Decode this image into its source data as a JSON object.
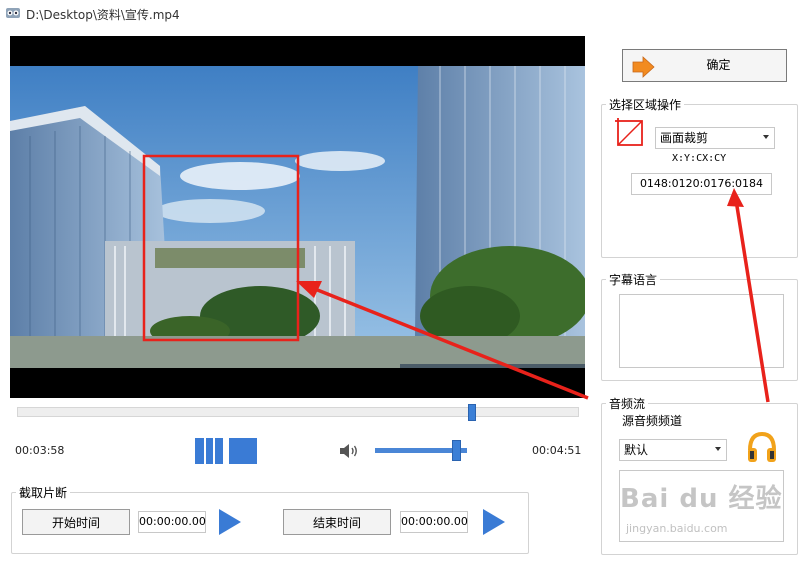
{
  "window": {
    "title": "D:\\Desktop\\资料\\宣传.mp4"
  },
  "player": {
    "current_time": "00:03:58",
    "total_time": "00:04:51",
    "seek_fraction": 0.81,
    "volume_fraction": 0.88
  },
  "clip": {
    "legend": "截取片断",
    "start_label": "开始时间",
    "start_value": "00:00:00.00",
    "end_label": "结束时间",
    "end_value": "00:00:00.00"
  },
  "confirm": {
    "label": "确定"
  },
  "region": {
    "legend": "选择区域操作",
    "mode": "画面裁剪",
    "coord_header": "X:Y:CX:CY",
    "coord_value": "0148:0120:0176:0184"
  },
  "subtitle": {
    "legend": "字幕语言"
  },
  "audio": {
    "legend": "音频流",
    "channel_label": "源音频频道",
    "channel_value": "默认"
  },
  "colors": {
    "accent": "#3a7bd5",
    "annotation_red": "#e8221b"
  },
  "watermark": {
    "text": "Bai du 经验",
    "sub": "jingyan.baidu.com"
  }
}
